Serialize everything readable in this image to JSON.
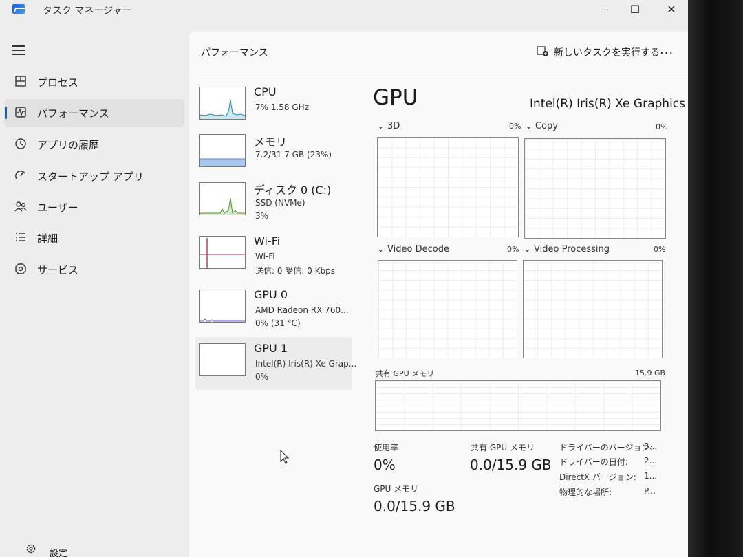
{
  "window": {
    "title": "タスク マネージャー",
    "minimize": "–",
    "maximize": "☐",
    "close": "✕"
  },
  "nav": {
    "items": [
      {
        "label": "プロセス",
        "icon": "processes-icon"
      },
      {
        "label": "パフォーマンス",
        "icon": "performance-icon"
      },
      {
        "label": "アプリの履歴",
        "icon": "history-icon"
      },
      {
        "label": "スタートアップ アプリ",
        "icon": "startup-icon"
      },
      {
        "label": "ユーザー",
        "icon": "users-icon"
      },
      {
        "label": "詳細",
        "icon": "details-icon"
      },
      {
        "label": "サービス",
        "icon": "services-icon"
      }
    ],
    "settings_label": "設定"
  },
  "header": {
    "title": "パフォーマンス",
    "run_task": "新しいタスクを実行する",
    "more": "..."
  },
  "devices": [
    {
      "name": "CPU",
      "sub": "7%  1.58 GHz",
      "sub2": ""
    },
    {
      "name": "メモリ",
      "sub": "7.2/31.7 GB (23%)",
      "sub2": ""
    },
    {
      "name": "ディスク 0 (C:)",
      "sub": "SSD (NVMe)",
      "sub2": "3%"
    },
    {
      "name": "Wi-Fi",
      "sub": "Wi-Fi",
      "sub2": "送信: 0  受信: 0 Kbps"
    },
    {
      "name": "GPU 0",
      "sub": "AMD Radeon RX 760...",
      "sub2": "0% (31 °C)"
    },
    {
      "name": "GPU 1",
      "sub": "Intel(R) Iris(R) Xe Grap...",
      "sub2": "0%"
    }
  ],
  "detail": {
    "title": "GPU",
    "model": "Intel(R) Iris(R) Xe Graphics",
    "engines": [
      {
        "label": "3D",
        "pct": "0%"
      },
      {
        "label": "Copy",
        "pct": "0%"
      },
      {
        "label": "Video Decode",
        "pct": "0%"
      },
      {
        "label": "Video Processing",
        "pct": "0%"
      }
    ],
    "shared_mem_label": "共有 GPU メモリ",
    "shared_mem_max": "15.9 GB",
    "stats": {
      "usage_label": "使用率",
      "usage_value": "0%",
      "shared_label": "共有 GPU メモリ",
      "shared_value": "0.0/15.9 GB",
      "dedicated_label": "GPU メモリ",
      "dedicated_value": "0.0/15.9 GB"
    },
    "props": [
      {
        "key": "ドライバーのバージョン:",
        "value": "3..."
      },
      {
        "key": "ドライバーの日付:",
        "value": "2..."
      },
      {
        "key": "DirectX バージョン:",
        "value": "1..."
      },
      {
        "key": "物理的な場所:",
        "value": "P..."
      }
    ]
  },
  "colors": {
    "cpu": "#1b8fb0",
    "memory": "#8cb0e0",
    "disk": "#4d9a2a",
    "wifi": "#b1364a",
    "gpu": "#6a5acd"
  }
}
